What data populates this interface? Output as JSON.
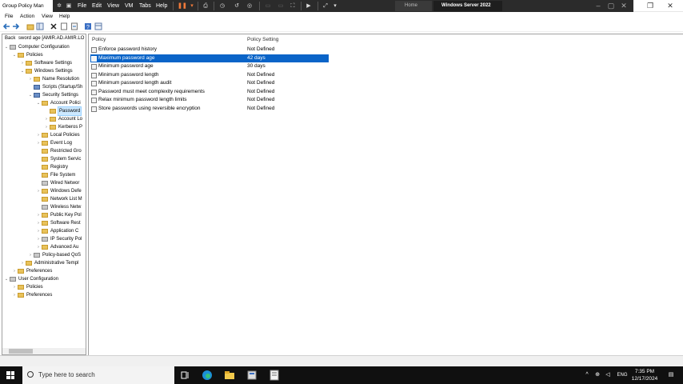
{
  "window": {
    "app_title": "Group Policy Man",
    "vm_menus": [
      "File",
      "Edit",
      "View",
      "VM",
      "Tabs",
      "Help"
    ],
    "tabs": [
      {
        "label": "Home",
        "active": false
      },
      {
        "label": "Windows Server 2022",
        "active": true
      }
    ]
  },
  "menubar": [
    "File",
    "Action",
    "View",
    "Help"
  ],
  "address": {
    "back_label": "Back",
    "path_text": "sword age [AMIR.AD.AMIR.LO"
  },
  "tree": {
    "items": [
      {
        "label": "Computer Configuration",
        "level": 0,
        "expander": "minus",
        "icon": "computer"
      },
      {
        "label": "Policies",
        "level": 1,
        "expander": "minus",
        "icon": "folder"
      },
      {
        "label": "Software Settings",
        "level": 2,
        "expander": "plus",
        "icon": "folder"
      },
      {
        "label": "Windows Settings",
        "level": 2,
        "expander": "minus",
        "icon": "folder"
      },
      {
        "label": "Name Resolution",
        "level": 3,
        "expander": "plus",
        "icon": "folder"
      },
      {
        "label": "Scripts (Startup/Sh",
        "level": 3,
        "expander": "",
        "icon": "script"
      },
      {
        "label": "Security Settings",
        "level": 3,
        "expander": "minus",
        "icon": "security"
      },
      {
        "label": "Account Polici",
        "level": 4,
        "expander": "minus",
        "icon": "folder"
      },
      {
        "label": "Password",
        "level": 5,
        "expander": "",
        "icon": "folder",
        "selected": true
      },
      {
        "label": "Account Lo",
        "level": 5,
        "expander": "plus",
        "icon": "folder"
      },
      {
        "label": "Kerberos P",
        "level": 5,
        "expander": "plus",
        "icon": "folder"
      },
      {
        "label": "Local Policies",
        "level": 4,
        "expander": "plus",
        "icon": "folder"
      },
      {
        "label": "Event Log",
        "level": 4,
        "expander": "plus",
        "icon": "folder"
      },
      {
        "label": "Restricted Gro",
        "level": 4,
        "expander": "",
        "icon": "folder"
      },
      {
        "label": "System Servic",
        "level": 4,
        "expander": "",
        "icon": "folder"
      },
      {
        "label": "Registry",
        "level": 4,
        "expander": "",
        "icon": "folder"
      },
      {
        "label": "File System",
        "level": 4,
        "expander": "",
        "icon": "folder"
      },
      {
        "label": "Wired Networ",
        "level": 4,
        "expander": "",
        "icon": "gray"
      },
      {
        "label": "Windows Defe",
        "level": 4,
        "expander": "plus",
        "icon": "folder"
      },
      {
        "label": "Network List M",
        "level": 4,
        "expander": "",
        "icon": "folder"
      },
      {
        "label": "Wireless Netw",
        "level": 4,
        "expander": "",
        "icon": "gray"
      },
      {
        "label": "Public Key Pol",
        "level": 4,
        "expander": "plus",
        "icon": "folder"
      },
      {
        "label": "Software Rest",
        "level": 4,
        "expander": "plus",
        "icon": "folder"
      },
      {
        "label": "Application C",
        "level": 4,
        "expander": "plus",
        "icon": "folder"
      },
      {
        "label": "IP Security Pol",
        "level": 4,
        "expander": "plus",
        "icon": "gray"
      },
      {
        "label": "Advanced Au",
        "level": 4,
        "expander": "plus",
        "icon": "folder"
      },
      {
        "label": "Policy-based QoS",
        "level": 3,
        "expander": "plus",
        "icon": "gray"
      },
      {
        "label": "Administrative Templ",
        "level": 2,
        "expander": "plus",
        "icon": "folder"
      },
      {
        "label": "Preferences",
        "level": 1,
        "expander": "plus",
        "icon": "folder"
      },
      {
        "label": "User Configuration",
        "level": 0,
        "expander": "minus",
        "icon": "computer"
      },
      {
        "label": "Policies",
        "level": 1,
        "expander": "plus",
        "icon": "folder"
      },
      {
        "label": "Preferences",
        "level": 1,
        "expander": "plus",
        "icon": "folder"
      }
    ]
  },
  "list": {
    "columns": [
      "Policy",
      "Policy Setting"
    ],
    "rows": [
      {
        "policy": "Enforce password history",
        "setting": "Not Defined",
        "selected": false
      },
      {
        "policy": "Maximum password age",
        "setting": "42 days",
        "selected": true
      },
      {
        "policy": "Minimum password age",
        "setting": "30 days",
        "selected": false
      },
      {
        "policy": "Minimum password length",
        "setting": "Not Defined",
        "selected": false
      },
      {
        "policy": "Minimum password length audit",
        "setting": "Not Defined",
        "selected": false
      },
      {
        "policy": "Password must meet complexity requirements",
        "setting": "Not Defined",
        "selected": false
      },
      {
        "policy": "Relax minimum password length limits",
        "setting": "Not Defined",
        "selected": false
      },
      {
        "policy": "Store passwords using reversible encryption",
        "setting": "Not Defined",
        "selected": false
      }
    ]
  },
  "taskbar": {
    "search_placeholder": "Type here to search",
    "language": "ENG",
    "time": "7:35 PM",
    "date": "12/17/2024"
  },
  "colors": {
    "selection": "#0a64c8",
    "taskbar": "#101010",
    "vm_toolbar": "#2b2b2b"
  }
}
